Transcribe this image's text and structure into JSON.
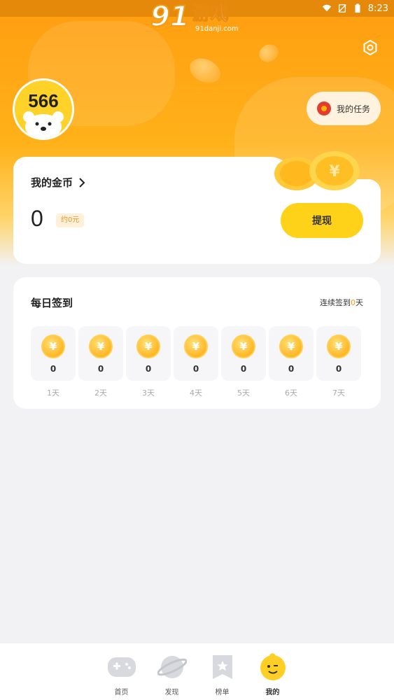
{
  "status_bar": {
    "time": "8:23"
  },
  "watermark": {
    "logo_num": "91",
    "logo_cn": "游戏",
    "site": "91danji.com"
  },
  "avatar": {
    "label": "566"
  },
  "task_button": {
    "label": "我的任务"
  },
  "gold": {
    "title": "我的金币",
    "value": "0",
    "approx": "约0元",
    "withdraw_label": "提现"
  },
  "signin": {
    "title": "每日签到",
    "streak_prefix": "连续签到",
    "streak_count": "0",
    "streak_suffix": "天",
    "coin_symbol": "¥",
    "days": [
      {
        "value": "0",
        "label": "1天"
      },
      {
        "value": "0",
        "label": "2天"
      },
      {
        "value": "0",
        "label": "3天"
      },
      {
        "value": "0",
        "label": "4天"
      },
      {
        "value": "0",
        "label": "5天"
      },
      {
        "value": "0",
        "label": "6天"
      },
      {
        "value": "0",
        "label": "7天"
      }
    ]
  },
  "nav": {
    "items": [
      {
        "label": "首页",
        "icon": "gamepad-icon"
      },
      {
        "label": "发现",
        "icon": "planet-icon"
      },
      {
        "label": "榜单",
        "icon": "bookmark-star-icon"
      },
      {
        "label": "我的",
        "icon": "smiley-icon"
      }
    ]
  },
  "colors": {
    "accent": "#ffd21a",
    "header": "#ff9d10",
    "highlight": "#ff9a1a"
  }
}
